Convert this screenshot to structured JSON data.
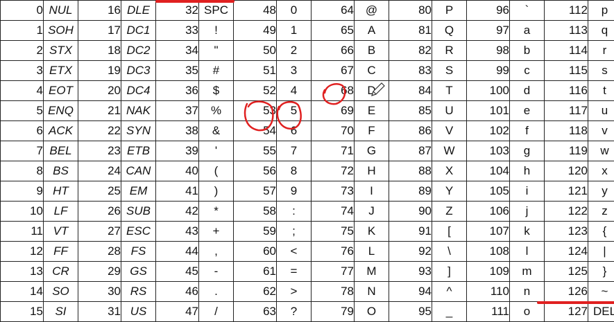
{
  "table": {
    "rows": [
      [
        {
          "n": "0",
          "c": "NUL"
        },
        {
          "n": "16",
          "c": "DLE"
        },
        {
          "n": "32",
          "c": "SPC"
        },
        {
          "n": "48",
          "c": "0"
        },
        {
          "n": "64",
          "c": "@"
        },
        {
          "n": "80",
          "c": "P"
        },
        {
          "n": "96",
          "c": "`"
        },
        {
          "n": "112",
          "c": "p"
        }
      ],
      [
        {
          "n": "1",
          "c": "SOH"
        },
        {
          "n": "17",
          "c": "DC1"
        },
        {
          "n": "33",
          "c": "!"
        },
        {
          "n": "49",
          "c": "1"
        },
        {
          "n": "65",
          "c": "A"
        },
        {
          "n": "81",
          "c": "Q"
        },
        {
          "n": "97",
          "c": "a"
        },
        {
          "n": "113",
          "c": "q"
        }
      ],
      [
        {
          "n": "2",
          "c": "STX"
        },
        {
          "n": "18",
          "c": "DC2"
        },
        {
          "n": "34",
          "c": "\""
        },
        {
          "n": "50",
          "c": "2"
        },
        {
          "n": "66",
          "c": "B"
        },
        {
          "n": "82",
          "c": "R"
        },
        {
          "n": "98",
          "c": "b"
        },
        {
          "n": "114",
          "c": "r"
        }
      ],
      [
        {
          "n": "3",
          "c": "ETX"
        },
        {
          "n": "19",
          "c": "DC3"
        },
        {
          "n": "35",
          "c": "#"
        },
        {
          "n": "51",
          "c": "3"
        },
        {
          "n": "67",
          "c": "C"
        },
        {
          "n": "83",
          "c": "S"
        },
        {
          "n": "99",
          "c": "c"
        },
        {
          "n": "115",
          "c": "s"
        }
      ],
      [
        {
          "n": "4",
          "c": "EOT"
        },
        {
          "n": "20",
          "c": "DC4"
        },
        {
          "n": "36",
          "c": "$"
        },
        {
          "n": "52",
          "c": "4"
        },
        {
          "n": "68",
          "c": "D"
        },
        {
          "n": "84",
          "c": "T"
        },
        {
          "n": "100",
          "c": "d"
        },
        {
          "n": "116",
          "c": "t"
        }
      ],
      [
        {
          "n": "5",
          "c": "ENQ"
        },
        {
          "n": "21",
          "c": "NAK"
        },
        {
          "n": "37",
          "c": "%"
        },
        {
          "n": "53",
          "c": "5"
        },
        {
          "n": "69",
          "c": "E"
        },
        {
          "n": "85",
          "c": "U"
        },
        {
          "n": "101",
          "c": "e"
        },
        {
          "n": "117",
          "c": "u"
        }
      ],
      [
        {
          "n": "6",
          "c": "ACK"
        },
        {
          "n": "22",
          "c": "SYN"
        },
        {
          "n": "38",
          "c": "&"
        },
        {
          "n": "54",
          "c": "6"
        },
        {
          "n": "70",
          "c": "F"
        },
        {
          "n": "86",
          "c": "V"
        },
        {
          "n": "102",
          "c": "f"
        },
        {
          "n": "118",
          "c": "v"
        }
      ],
      [
        {
          "n": "7",
          "c": "BEL"
        },
        {
          "n": "23",
          "c": "ETB"
        },
        {
          "n": "39",
          "c": "'"
        },
        {
          "n": "55",
          "c": "7"
        },
        {
          "n": "71",
          "c": "G"
        },
        {
          "n": "87",
          "c": "W"
        },
        {
          "n": "103",
          "c": "g"
        },
        {
          "n": "119",
          "c": "w"
        }
      ],
      [
        {
          "n": "8",
          "c": "BS"
        },
        {
          "n": "24",
          "c": "CAN"
        },
        {
          "n": "40",
          "c": "("
        },
        {
          "n": "56",
          "c": "8"
        },
        {
          "n": "72",
          "c": "H"
        },
        {
          "n": "88",
          "c": "X"
        },
        {
          "n": "104",
          "c": "h"
        },
        {
          "n": "120",
          "c": "x"
        }
      ],
      [
        {
          "n": "9",
          "c": "HT"
        },
        {
          "n": "25",
          "c": "EM"
        },
        {
          "n": "41",
          "c": ")"
        },
        {
          "n": "57",
          "c": "9"
        },
        {
          "n": "73",
          "c": "I"
        },
        {
          "n": "89",
          "c": "Y"
        },
        {
          "n": "105",
          "c": "i"
        },
        {
          "n": "121",
          "c": "y"
        }
      ],
      [
        {
          "n": "10",
          "c": "LF"
        },
        {
          "n": "26",
          "c": "SUB"
        },
        {
          "n": "42",
          "c": "*"
        },
        {
          "n": "58",
          "c": ":"
        },
        {
          "n": "74",
          "c": "J"
        },
        {
          "n": "90",
          "c": "Z"
        },
        {
          "n": "106",
          "c": "j"
        },
        {
          "n": "122",
          "c": "z"
        }
      ],
      [
        {
          "n": "11",
          "c": "VT"
        },
        {
          "n": "27",
          "c": "ESC"
        },
        {
          "n": "43",
          "c": "+"
        },
        {
          "n": "59",
          "c": ";"
        },
        {
          "n": "75",
          "c": "K"
        },
        {
          "n": "91",
          "c": "["
        },
        {
          "n": "107",
          "c": "k"
        },
        {
          "n": "123",
          "c": "{"
        }
      ],
      [
        {
          "n": "12",
          "c": "FF"
        },
        {
          "n": "28",
          "c": "FS"
        },
        {
          "n": "44",
          "c": ","
        },
        {
          "n": "60",
          "c": "<"
        },
        {
          "n": "76",
          "c": "L"
        },
        {
          "n": "92",
          "c": "\\"
        },
        {
          "n": "108",
          "c": "l"
        },
        {
          "n": "124",
          "c": "|"
        }
      ],
      [
        {
          "n": "13",
          "c": "CR"
        },
        {
          "n": "29",
          "c": "GS"
        },
        {
          "n": "45",
          "c": "-"
        },
        {
          "n": "61",
          "c": "="
        },
        {
          "n": "77",
          "c": "M"
        },
        {
          "n": "93",
          "c": "]"
        },
        {
          "n": "109",
          "c": "m"
        },
        {
          "n": "125",
          "c": "}"
        }
      ],
      [
        {
          "n": "14",
          "c": "SO"
        },
        {
          "n": "30",
          "c": "RS"
        },
        {
          "n": "46",
          "c": "."
        },
        {
          "n": "62",
          "c": ">"
        },
        {
          "n": "78",
          "c": "N"
        },
        {
          "n": "94",
          "c": "^"
        },
        {
          "n": "110",
          "c": "n"
        },
        {
          "n": "126",
          "c": "~"
        }
      ],
      [
        {
          "n": "15",
          "c": "SI"
        },
        {
          "n": "31",
          "c": "US"
        },
        {
          "n": "47",
          "c": "/"
        },
        {
          "n": "63",
          "c": "?"
        },
        {
          "n": "79",
          "c": "O"
        },
        {
          "n": "95",
          "c": "_"
        },
        {
          "n": "111",
          "c": "o"
        },
        {
          "n": "127",
          "c": "DEL"
        }
      ]
    ]
  },
  "annotation": {
    "ink_color": "#e02020",
    "circled_cells": [
      "53",
      "5",
      "68"
    ],
    "pencil_cursor_icon": "pencil-icon"
  }
}
